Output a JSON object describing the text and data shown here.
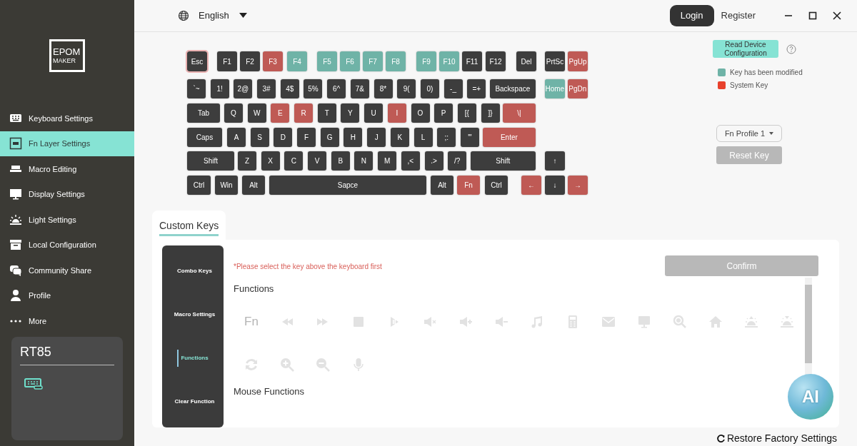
{
  "logo": {
    "line_1": "EPOM",
    "line_2": "MAKER"
  },
  "sidebar": {
    "items": [
      {
        "label": "Keyboard Settings",
        "selected": false
      },
      {
        "label": "Fn Layer Settings",
        "selected": true
      },
      {
        "label": "Macro Editing",
        "selected": false
      },
      {
        "label": "Display Settings",
        "selected": false
      },
      {
        "label": "Light Settings",
        "selected": false
      },
      {
        "label": "Local Configuration",
        "selected": false
      },
      {
        "label": "Community Share",
        "selected": false
      },
      {
        "label": "Profile",
        "selected": false
      },
      {
        "label": "More",
        "selected": false
      }
    ]
  },
  "device": {
    "name": "RT85"
  },
  "topbar": {
    "language": "English",
    "login": "Login",
    "register": "Register"
  },
  "keyboard": {
    "rows": [
      {
        "keys": [
          {
            "label": "Esc",
            "color": "#3d3d3d",
            "selected": true
          },
          {
            "label": "F1",
            "color": "#3d3d3d",
            "selected": false
          },
          {
            "label": "F2",
            "color": "#3d3d3d",
            "selected": false
          },
          {
            "label": "F3",
            "color": "#bf5a55",
            "selected": false
          },
          {
            "label": "F4",
            "color": "#6fb3a7",
            "selected": false
          },
          {
            "label": "F5",
            "color": "#6fb3a7",
            "selected": false
          },
          {
            "label": "F6",
            "color": "#6fb3a7",
            "selected": false
          },
          {
            "label": "F7",
            "color": "#6fb3a7",
            "selected": false
          },
          {
            "label": "F8",
            "color": "#6fb3a7",
            "selected": false
          },
          {
            "label": "F9",
            "color": "#6fb3a7",
            "selected": false
          },
          {
            "label": "F10",
            "color": "#6fb3a7",
            "selected": false
          },
          {
            "label": "F11",
            "color": "#3d3d3d",
            "selected": false
          },
          {
            "label": "F12",
            "color": "#3d3d3d",
            "selected": false
          }
        ]
      },
      {
        "keys": [
          {
            "label": "`~",
            "color": "#3d3d3d",
            "selected": false
          },
          {
            "label": "1!",
            "color": "#3d3d3d",
            "selected": false
          },
          {
            "label": "2@",
            "color": "#3d3d3d",
            "selected": false
          },
          {
            "label": "3#",
            "color": "#3d3d3d",
            "selected": false
          },
          {
            "label": "4$",
            "color": "#3d3d3d",
            "selected": false
          },
          {
            "label": "5%",
            "color": "#3d3d3d",
            "selected": false
          },
          {
            "label": "6^",
            "color": "#3d3d3d",
            "selected": false
          },
          {
            "label": "7&",
            "color": "#3d3d3d",
            "selected": false
          },
          {
            "label": "8*",
            "color": "#3d3d3d",
            "selected": false
          },
          {
            "label": "9(",
            "color": "#3d3d3d",
            "selected": false
          },
          {
            "label": "0)",
            "color": "#3d3d3d",
            "selected": false
          },
          {
            "label": "-_",
            "color": "#3d3d3d",
            "selected": false
          },
          {
            "label": "=+",
            "color": "#3d3d3d",
            "selected": false
          },
          {
            "label": "Backspace",
            "color": "#3d3d3d",
            "selected": false
          }
        ]
      },
      {
        "keys": [
          {
            "label": "Tab",
            "color": "#3d3d3d",
            "selected": false
          },
          {
            "label": "Q",
            "color": "#3d3d3d",
            "selected": false
          },
          {
            "label": "W",
            "color": "#3d3d3d",
            "selected": false
          },
          {
            "label": "E",
            "color": "#bf5a55",
            "selected": false
          },
          {
            "label": "R",
            "color": "#bf5a55",
            "selected": false
          },
          {
            "label": "T",
            "color": "#3d3d3d",
            "selected": false
          },
          {
            "label": "Y",
            "color": "#3d3d3d",
            "selected": false
          },
          {
            "label": "U",
            "color": "#3d3d3d",
            "selected": false
          },
          {
            "label": "I",
            "color": "#bf5a55",
            "selected": false
          },
          {
            "label": "O",
            "color": "#3d3d3d",
            "selected": false
          },
          {
            "label": "P",
            "color": "#3d3d3d",
            "selected": false
          },
          {
            "label": "[{",
            "color": "#3d3d3d",
            "selected": false
          },
          {
            "label": "]}",
            "color": "#3d3d3d",
            "selected": false
          },
          {
            "label": "\\|",
            "color": "#bf5a55",
            "selected": false
          }
        ]
      },
      {
        "keys": [
          {
            "label": "Caps",
            "color": "#3d3d3d",
            "selected": false
          },
          {
            "label": "A",
            "color": "#3d3d3d",
            "selected": false
          },
          {
            "label": "S",
            "color": "#3d3d3d",
            "selected": false
          },
          {
            "label": "D",
            "color": "#3d3d3d",
            "selected": false
          },
          {
            "label": "F",
            "color": "#3d3d3d",
            "selected": false
          },
          {
            "label": "G",
            "color": "#3d3d3d",
            "selected": false
          },
          {
            "label": "H",
            "color": "#3d3d3d",
            "selected": false
          },
          {
            "label": "J",
            "color": "#3d3d3d",
            "selected": false
          },
          {
            "label": "K",
            "color": "#3d3d3d",
            "selected": false
          },
          {
            "label": "L",
            "color": "#3d3d3d",
            "selected": false
          },
          {
            "label": ";:",
            "color": "#3d3d3d",
            "selected": false
          },
          {
            "label": "'\"",
            "color": "#3d3d3d",
            "selected": false
          },
          {
            "label": "Enter",
            "color": "#bf5a55",
            "selected": false
          }
        ]
      },
      {
        "keys": [
          {
            "label": "Shift",
            "color": "#3d3d3d",
            "selected": false
          },
          {
            "label": "Z",
            "color": "#3d3d3d",
            "selected": false
          },
          {
            "label": "X",
            "color": "#3d3d3d",
            "selected": false
          },
          {
            "label": "C",
            "color": "#3d3d3d",
            "selected": false
          },
          {
            "label": "V",
            "color": "#3d3d3d",
            "selected": false
          },
          {
            "label": "B",
            "color": "#3d3d3d",
            "selected": false
          },
          {
            "label": "N",
            "color": "#3d3d3d",
            "selected": false
          },
          {
            "label": "M",
            "color": "#3d3d3d",
            "selected": false
          },
          {
            "label": ",<",
            "color": "#3d3d3d",
            "selected": false
          },
          {
            "label": ".>",
            "color": "#3d3d3d",
            "selected": false
          },
          {
            "label": "/?",
            "color": "#3d3d3d",
            "selected": false
          },
          {
            "label": "Shift",
            "color": "#3d3d3d",
            "selected": false
          }
        ]
      },
      {
        "keys": [
          {
            "label": "Ctrl",
            "color": "#3d3d3d",
            "selected": false
          },
          {
            "label": "Win",
            "color": "#3d3d3d",
            "selected": false
          },
          {
            "label": "Alt",
            "color": "#3d3d3d",
            "selected": false
          },
          {
            "label": "Sapce",
            "color": "#3d3d3d",
            "selected": false
          },
          {
            "label": "Alt",
            "color": "#3d3d3d",
            "selected": false
          },
          {
            "label": "Fn",
            "color": "#bf5a55",
            "selected": false
          },
          {
            "label": "Ctrl",
            "color": "#3d3d3d",
            "selected": false
          }
        ]
      }
    ],
    "nav_rows": [
      [
        {
          "label": "Del",
          "color": "#3d3d3d",
          "selected": false
        },
        {
          "label": "PrtSc",
          "color": "#3d3d3d",
          "selected": false
        },
        {
          "label": "PgUp",
          "color": "#bf5a55",
          "selected": false
        }
      ],
      [
        null,
        {
          "label": "Home",
          "color": "#6fb3a7",
          "selected": false
        },
        {
          "label": "PgDn",
          "color": "#bf5a55",
          "selected": false
        }
      ],
      [
        null,
        null,
        null
      ],
      [
        null,
        null,
        null
      ],
      [
        null,
        {
          "label": "↑",
          "color": "#3d3d3d",
          "selected": false
        },
        null
      ],
      [
        {
          "label": "←",
          "color": "#bf5a55",
          "selected": false
        },
        {
          "label": "↓",
          "color": "#3d3d3d",
          "selected": false
        },
        {
          "label": "→",
          "color": "#bf5a55",
          "selected": false
        }
      ]
    ]
  },
  "read_button": {
    "label": "Read Device Configuration"
  },
  "legend": [
    {
      "label": "Key has been modified",
      "color": "#6fb3a7"
    },
    {
      "label": "System Key",
      "color": "#e8412c"
    }
  ],
  "profile_select": {
    "value": "Fn Profile 1"
  },
  "reset_button": {
    "label": "Reset Key",
    "disabled": true
  },
  "tabs": [
    {
      "label": "Custom Keys",
      "selected": true
    }
  ],
  "custom_menu": [
    {
      "label": "Combo Keys",
      "selected": false
    },
    {
      "label": "Macro Settings",
      "selected": false
    },
    {
      "label": "Functions",
      "selected": true
    },
    {
      "label": "Clear Function",
      "selected": false
    }
  ],
  "hint": "*Please select the key above the keyboard first",
  "confirm_button": {
    "label": "Confirm",
    "disabled": true
  },
  "sections": [
    {
      "title": "Functions",
      "functions": [
        {
          "kind": "text",
          "label": "Fn"
        },
        {
          "kind": "rewind"
        },
        {
          "kind": "forward"
        },
        {
          "kind": "stop"
        },
        {
          "kind": "play"
        },
        {
          "kind": "mute"
        },
        {
          "kind": "volup"
        },
        {
          "kind": "voldown"
        },
        {
          "kind": "music"
        },
        {
          "kind": "calc"
        },
        {
          "kind": "mail"
        },
        {
          "kind": "monitor"
        },
        {
          "kind": "search"
        },
        {
          "kind": "home"
        },
        {
          "kind": "brightup"
        },
        {
          "kind": "brightdown"
        },
        {
          "kind": "refresh"
        },
        {
          "kind": "zoomin"
        },
        {
          "kind": "zoomout"
        },
        {
          "kind": "mic"
        }
      ]
    },
    {
      "title": "Mouse Functions"
    }
  ],
  "ai_button": {
    "label": "AI"
  },
  "restore_link": "Restore Factory Settings"
}
